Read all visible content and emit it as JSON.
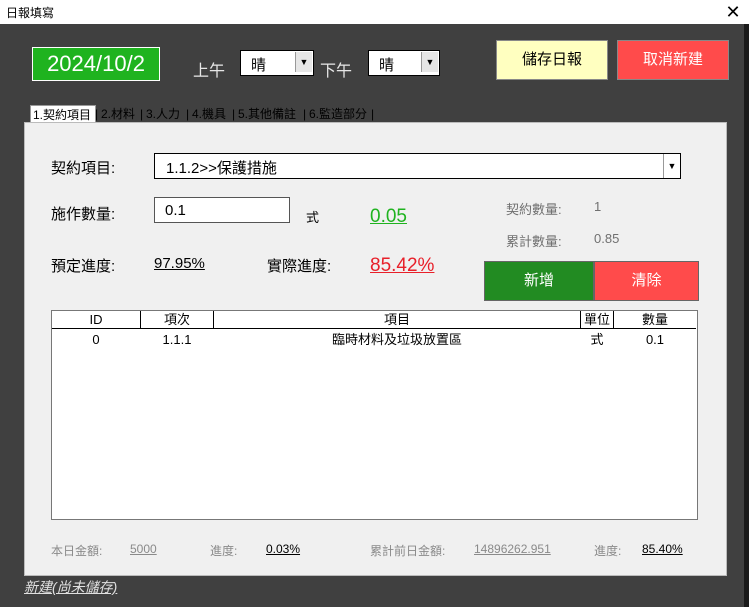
{
  "window": {
    "title": "日報填寫",
    "close_glyph": "✕"
  },
  "header": {
    "date": "2024/10/2",
    "am_label": "上午",
    "am_weather": "晴",
    "pm_label": "下午",
    "pm_weather": "晴",
    "save_label": "儲存日報",
    "cancel_label": "取消新建"
  },
  "tabs": [
    {
      "label": "1.契約項目"
    },
    {
      "label": "2.材料"
    },
    {
      "label": "3.人力"
    },
    {
      "label": "4.機具"
    },
    {
      "label": "5.其他備註"
    },
    {
      "label": "6.監造部分"
    }
  ],
  "form": {
    "contract_item_label": "契約項目:",
    "contract_item_value": "1.1.2>>保護措施",
    "qty_label": "施作數量:",
    "qty_value": "0.1",
    "unit": "式",
    "computed_ratio": "0.05",
    "contract_qty_label": "契約數量:",
    "contract_qty_value": "1",
    "cumulative_qty_label": "累計數量:",
    "cumulative_qty_value": "0.85",
    "planned_progress_label": "預定進度:",
    "planned_progress_value": "97.95%",
    "actual_progress_label": "實際進度:",
    "actual_progress_value": "85.42%",
    "add_label": "新增",
    "clear_label": "清除"
  },
  "table": {
    "columns": [
      "ID",
      "項次",
      "項目",
      "單位",
      "數量"
    ],
    "rows": [
      [
        "0",
        "1.1.1",
        "臨時材料及垃圾放置區",
        "式",
        "0.1"
      ]
    ]
  },
  "footer": {
    "today_amount_label": "本日金額:",
    "today_amount_value": "5000",
    "progress_label": "進度:",
    "progress_value": "0.03%",
    "cumulative_prev_label": "累計前日金額:",
    "cumulative_prev_value": "14896262.951",
    "progress2_label": "進度:",
    "progress2_value": "85.40%"
  },
  "status": {
    "text": "新建(尚未儲存)"
  },
  "colors": {
    "date_bg": "#1fb31f",
    "save_bg": "#ffffc0",
    "cancel_bg": "#ff4b4b",
    "add_bg": "#228b22",
    "ratio_green": "#1fb31f",
    "actual_red": "#e8202a"
  }
}
